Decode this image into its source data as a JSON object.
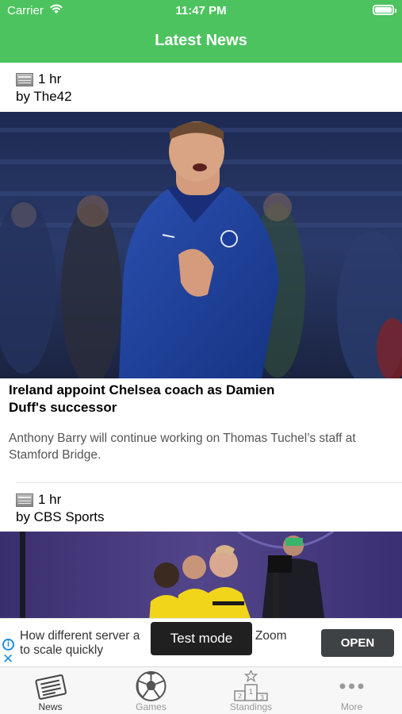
{
  "status_bar": {
    "carrier": "Carrier",
    "time": "11:47 PM"
  },
  "header": {
    "title": "Latest News"
  },
  "articles": [
    {
      "time_ago": "1 hr",
      "source": "by The42",
      "headline": "Ireland appoint Chelsea coach as Damien Duff's successor",
      "summary": "Anthony Barry will continue working on Thomas Tuchel’s staff at Stamford Bridge."
    },
    {
      "time_ago": "1 hr",
      "source": "by CBS Sports"
    }
  ],
  "ad": {
    "text": "How different server architectures helped Zoom to scale quickly",
    "text_visible": "How different server a",
    "text_visible_2": "ed Zoom",
    "text_line2": "to scale quickly",
    "button": "OPEN",
    "toast": "Test mode"
  },
  "tabs": [
    {
      "label": "News",
      "icon": "newspaper-icon",
      "active": true
    },
    {
      "label": "Games",
      "icon": "soccer-ball-icon",
      "active": false
    },
    {
      "label": "Standings",
      "icon": "podium-icon",
      "active": false
    },
    {
      "label": "More",
      "icon": "more-icon",
      "active": false
    }
  ],
  "colors": {
    "header_green": "#4cc35e",
    "ad_button": "#3f4244",
    "info_blue": "#1f8ddc"
  }
}
